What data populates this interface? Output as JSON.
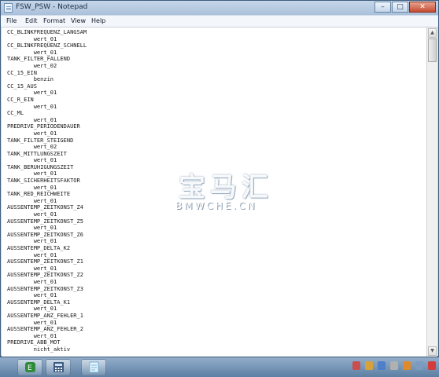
{
  "window": {
    "title": "FSW_PSW - Notepad",
    "controls": {
      "minimize": "–",
      "maximize": "□",
      "close": "✕"
    }
  },
  "menu": [
    "File",
    "Edit",
    "Format",
    "View",
    "Help"
  ],
  "document": {
    "lines": [
      "CC_BLINKFREQUENZ_LANGSAM",
      "        wert_01",
      "CC_BLINKFREQUENZ_SCHNELL",
      "        wert_01",
      "TANK_FILTER_FALLEND",
      "        wert_02",
      "CC_15_EIN",
      "        benzin",
      "CC_15_AUS",
      "        wert_01",
      "CC_R_EIN",
      "        wert_01",
      "CC_ML",
      "        wert_01",
      "PREDRIVE_PERIODENDAUER",
      "        wert_01",
      "TANK_FILTER_STEIGEND",
      "        wert_02",
      "TANK_MITTLUNGSZEIT",
      "        wert_01",
      "TANK_BERUHIGUNGSZEIT",
      "        wert_01",
      "TANK_SICHERHEITSFAKTOR",
      "        wert_01",
      "TANK_RED_REICHWEITE",
      "        wert_01",
      "AUSSENTEMP_ZEITKONST_Z4",
      "        wert_01",
      "AUSSENTEMP_ZEITKONST_Z5",
      "        wert_01",
      "AUSSENTEMP_ZEITKONST_Z6",
      "        wert_01",
      "AUSSENTEMP_DELTA_K2",
      "        wert_01",
      "AUSSENTEMP_ZEITKONST_Z1",
      "        wert_01",
      "AUSSENTEMP_ZEITKONST_Z2",
      "        wert_01",
      "AUSSENTEMP_ZEITKONST_Z3",
      "        wert_01",
      "AUSSENTEMP_DELTA_K1",
      "        wert_01",
      "AUSSENTEMP_ANZ_FEHLER_1",
      "        wert_01",
      "AUSSENTEMP_ANZ_FEHLER_2",
      "        wert_01",
      "PREDRIVE_ABB_MOT",
      "        nicht_aktiv"
    ]
  },
  "watermark": {
    "chinese": "宝马汇",
    "domain": "BMWCHE.CN"
  },
  "taskbar": {
    "buttons": [
      {
        "name": "taskbar-app-1",
        "icon": "green-e-icon",
        "color": "#2e8b3a"
      },
      {
        "name": "taskbar-app-2",
        "icon": "calculator-icon",
        "color": "#3d5a80"
      },
      {
        "name": "taskbar-notepad",
        "icon": "notepad-icon",
        "color": "#6fb3d9"
      }
    ],
    "tray_colors": [
      "#c94f4f",
      "#d8a23a",
      "#4f7fc9",
      "#b0b0b0",
      "#e08a2c",
      "#7b9cc0",
      "#d23c3c"
    ]
  }
}
